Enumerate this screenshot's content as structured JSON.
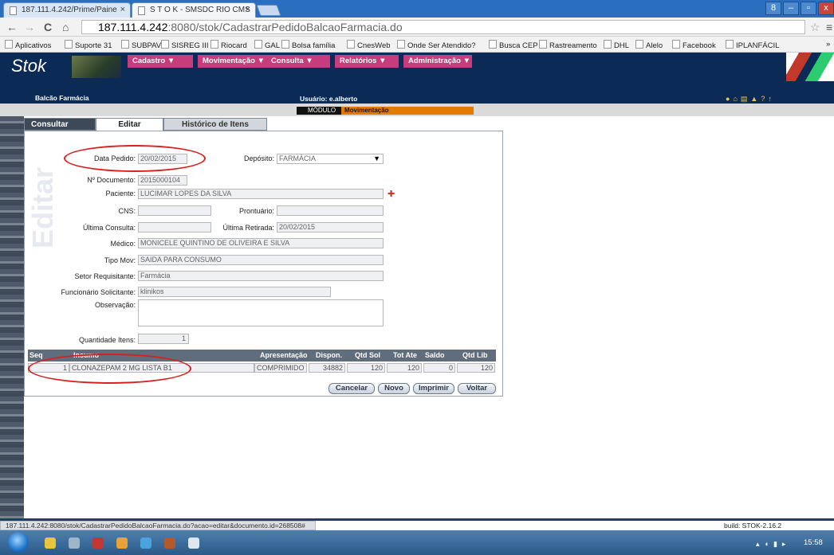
{
  "browser": {
    "tabs": [
      {
        "label": "187.111.4.242/Prime/Paine"
      },
      {
        "label": "S T O K - SMSDC RIO CMS"
      }
    ],
    "tab_close": "×",
    "window_buttons": [
      "8",
      "–",
      "▫",
      "x"
    ],
    "url_host": "187.111.4.242",
    "url_rest": ":8080/stok/CadastrarPedidoBalcaoFarmacia.do",
    "bookmarks": [
      "Aplicativos",
      "Suporte 31",
      "SUBPAV",
      "SISREG III",
      "Riocard",
      "GAL",
      "Bolsa família",
      "CnesWeb",
      "Onde Ser Atendido?",
      "Busca CEP",
      "Rastreamento",
      "DHL",
      "Alelo",
      "Facebook",
      "IPLANFÁCIL"
    ],
    "overflow": "»"
  },
  "app": {
    "logo": "Stok",
    "menus": [
      "Cadastro ▼",
      "Movimentação ▼",
      "Consulta ▼",
      "Relatórios ▼",
      "Administração ▼"
    ],
    "section": "Balcão Farmácia",
    "user": "Usuário: e.alberto",
    "module_label": "MÓDULO",
    "module_value": "Movimentação"
  },
  "page_tabs": [
    "Consultar",
    "Editar",
    "Histórico de Itens"
  ],
  "watermark": "Editar",
  "form": {
    "data_pedido_label": "Data Pedido:",
    "data_pedido": "20/02/2015",
    "deposito_label": "Depósito:",
    "deposito": "FARMÁCIA",
    "documento_label": "Nº Documento:",
    "documento": "2015000104",
    "paciente_label": "Paciente:",
    "paciente": "LUCIMAR LOPES DA SILVA",
    "cns_label": "CNS:",
    "cns": "",
    "prontuario_label": "Prontuário:",
    "prontuario": "",
    "ultima_consulta_label": "Última Consulta:",
    "ultima_consulta": "",
    "ultima_retirada_label": "Última Retirada:",
    "ultima_retirada": "20/02/2015",
    "medico_label": "Médico:",
    "medico": "MONICELE QUINTINO DE OLIVEIRA E SILVA",
    "tipo_mov_label": "Tipo Mov:",
    "tipo_mov": "SAIDA PARA CONSUMO",
    "setor_label": "Setor Requisitante:",
    "setor": "Farmácia",
    "funcionario_label": "Funcionário Solicitante:",
    "funcionario": "klinikos",
    "observacao_label": "Observação:",
    "observacao": "",
    "quantidade_label": "Quantidade Itens:",
    "quantidade": "1"
  },
  "grid": {
    "headers": [
      "Seq",
      "Insumo",
      "Apresentação",
      "Dispon.",
      "Qtd Sol",
      "Tot Ate",
      "Saldo",
      "Qtd Lib"
    ],
    "rows": [
      {
        "seq": "1",
        "insumo": "CLONAZEPAM 2 MG LISTA B1",
        "apresentacao": "COMPRIMIDO",
        "dispon": "34882",
        "qtd_sol": "120",
        "tot_ate": "120",
        "saldo": "0",
        "qtd_lib": "120"
      }
    ]
  },
  "buttons": {
    "cancelar": "Cancelar",
    "novo": "Novo",
    "imprimir": "Imprimir",
    "voltar": "Voltar"
  },
  "status": {
    "url": "187.111.4.242:8080/stok/CadastrarPedidoBalcaoFarmacia.do?acao=editar&documento.id=268508#",
    "build": "build: STOK-2.16.2"
  },
  "taskbar": {
    "clock": "15:58"
  },
  "colors": {
    "menu": "#c73c7c",
    "header": "#0b2a55",
    "module": "#e47a00",
    "highlight": "#d9201e"
  }
}
